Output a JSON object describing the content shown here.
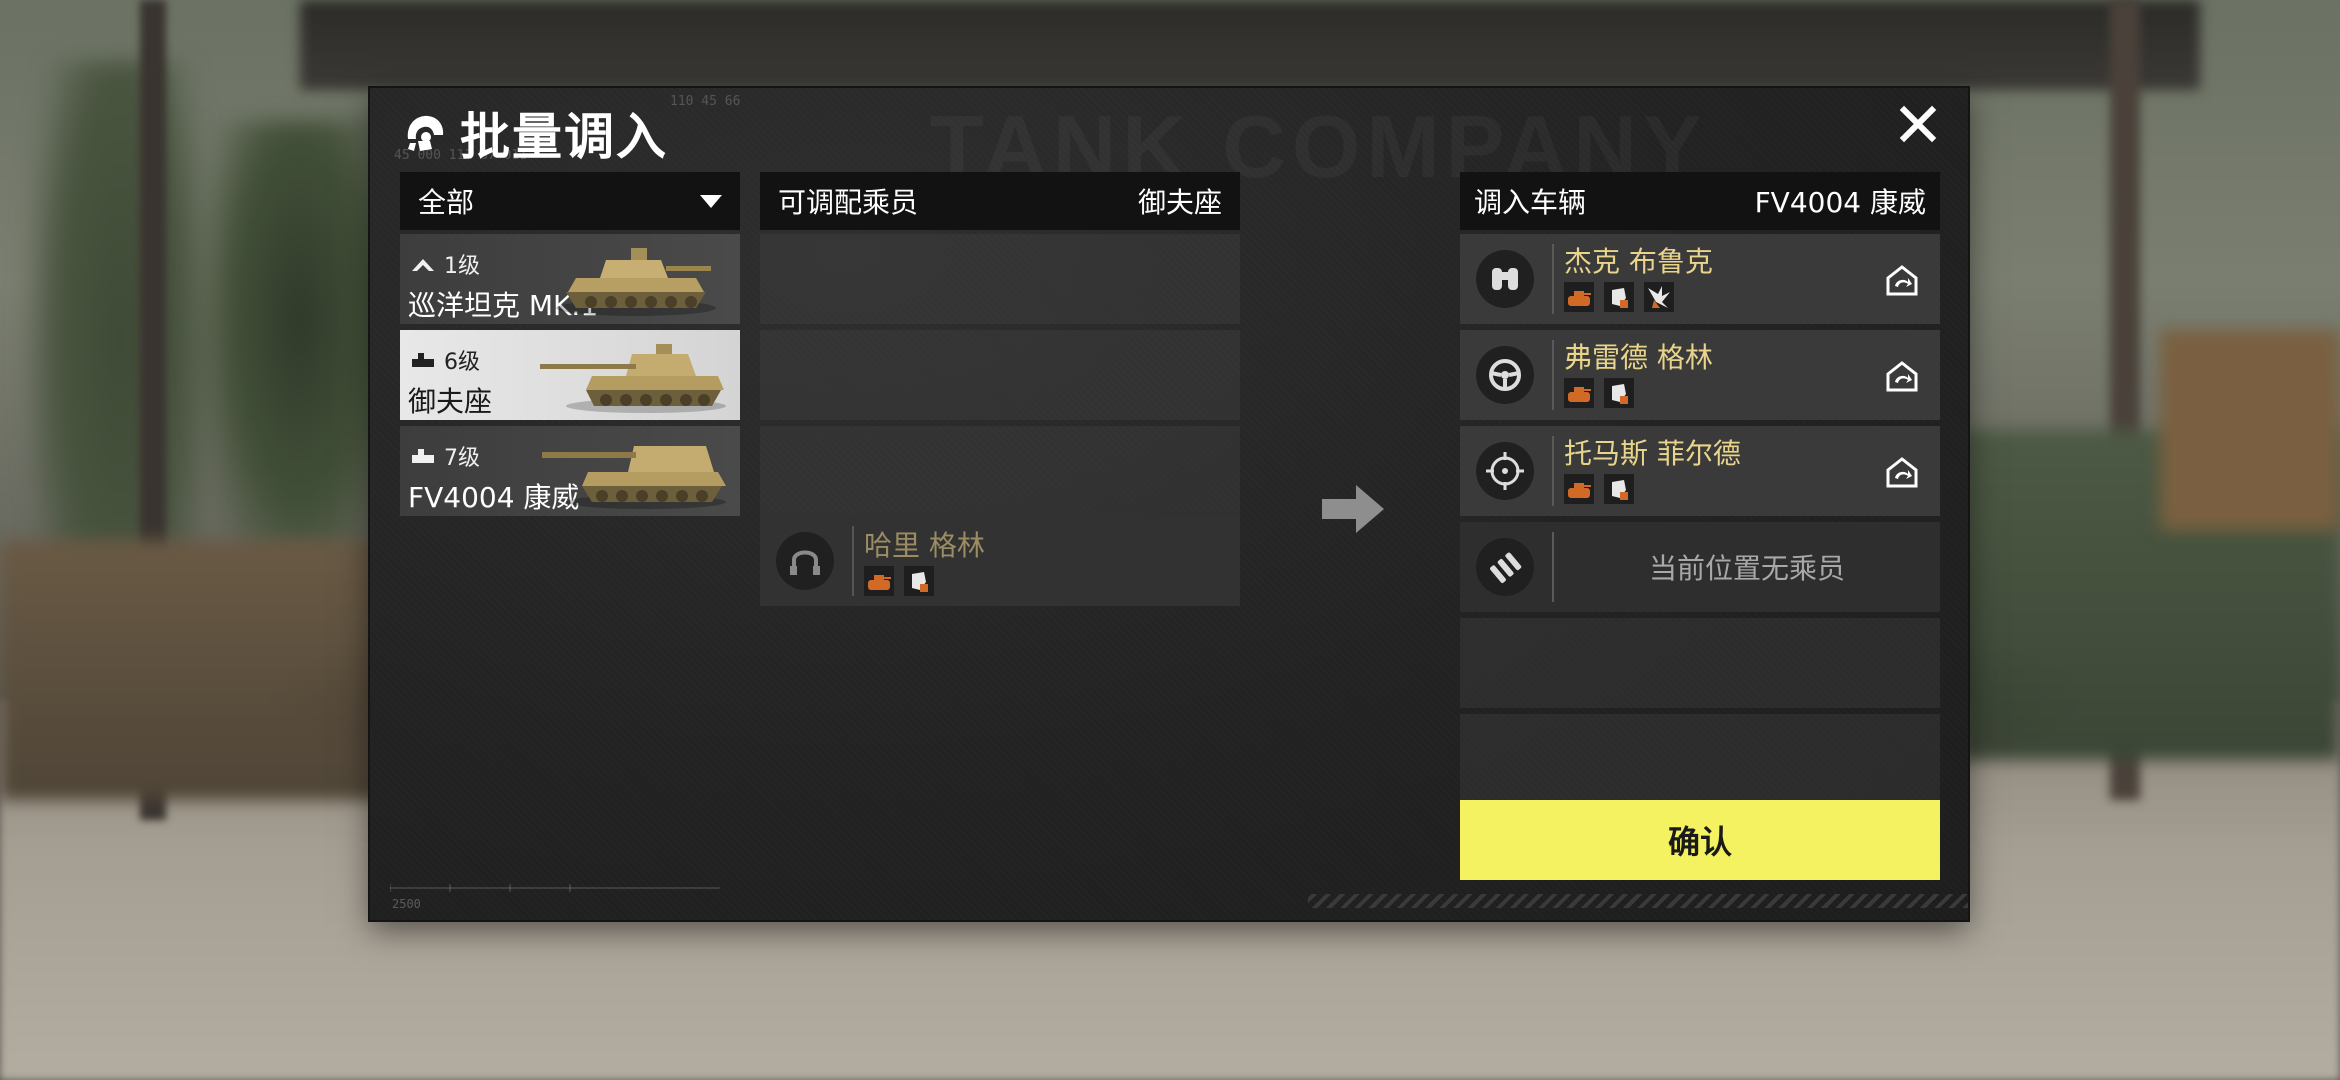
{
  "dialog": {
    "title": "批量调入",
    "close_icon": "close-icon",
    "deco_code_top": "110 45 66",
    "deco_code_left": "45 000 111 87 011",
    "deco_ruler": "2500"
  },
  "filter": {
    "label": "全部",
    "icon": "chevron-down-icon"
  },
  "vehicles": [
    {
      "tier": "1级",
      "name": "巡洋坦克 MK.1",
      "tier_icon": "rank-chevron-icon",
      "selected": false
    },
    {
      "tier": "6级",
      "name": "御夫座",
      "tier_icon": "rank-bar-icon",
      "selected": true
    },
    {
      "tier": "7级",
      "name": "FV4004 康威",
      "tier_icon": "rank-bar-icon",
      "selected": false
    }
  ],
  "available_crew": {
    "header": "可调配乘员",
    "vehicle": "御夫座",
    "members": [
      {
        "name": "哈里 格林",
        "role_icon": "headset-icon",
        "skills": [
          "skill-tank-icon",
          "skill-fist-icon"
        ]
      }
    ]
  },
  "transfer": {
    "header": "调入车辆",
    "vehicle": "FV4004 康威",
    "slots": [
      {
        "name": "杰克 布鲁克",
        "role_icon": "binoculars-icon",
        "skills": [
          "skill-tank-icon",
          "skill-fist-icon",
          "skill-burst-icon"
        ]
      },
      {
        "name": "弗雷德 格林",
        "role_icon": "steering-wheel-icon",
        "skills": [
          "skill-tank-icon",
          "skill-fist-icon"
        ]
      },
      {
        "name": "托马斯 菲尔德",
        "role_icon": "crosshair-icon",
        "skills": [
          "skill-tank-icon",
          "skill-fist-icon"
        ]
      }
    ],
    "empty_slot_text": "当前位置无乘员",
    "empty_role_icon": "ammo-icon"
  },
  "confirm_label": "确认",
  "colors": {
    "accent_yellow": "#f5f262",
    "crew_name": "#e8d48a",
    "crew_name_dim": "#9b8c62",
    "skill_orange": "#e07b2c"
  }
}
